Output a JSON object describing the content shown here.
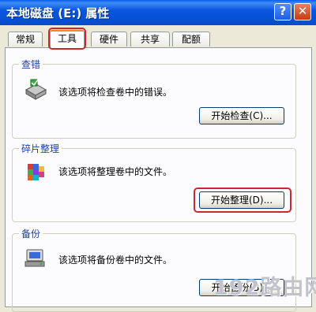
{
  "window": {
    "title": "本地磁盘 (E:) 属性",
    "help_label": "?",
    "close_label": "✕"
  },
  "tabs": [
    {
      "label": "常规"
    },
    {
      "label": "工具",
      "active": true
    },
    {
      "label": "硬件"
    },
    {
      "label": "共享"
    },
    {
      "label": "配额"
    }
  ],
  "groups": {
    "check": {
      "title": "查错",
      "description": "该选项将检查卷中的错误。",
      "button": "开始检查(C)...",
      "icon": "disk-check-icon"
    },
    "defrag": {
      "title": "碎片整理",
      "description": "该选项将整理卷中的文件。",
      "button": "开始整理(D)...",
      "icon": "defrag-icon"
    },
    "backup": {
      "title": "备份",
      "description": "该选项将备份卷中的文件。",
      "button": "开始备份(B)...",
      "icon": "backup-icon"
    }
  },
  "watermark": "192路由网",
  "colors": {
    "titlebar": "#0552d6",
    "highlight": "#d0262b",
    "group_title": "#1c3fa8"
  }
}
